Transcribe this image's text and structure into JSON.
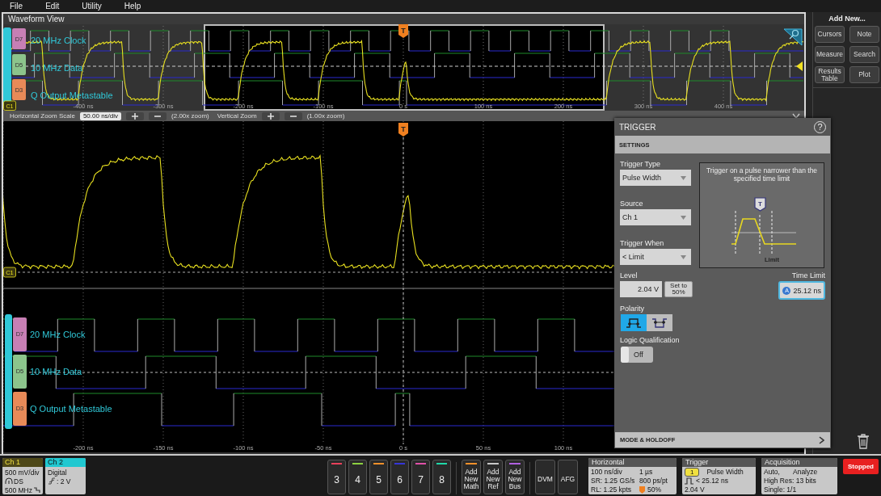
{
  "menu": [
    "File",
    "Edit",
    "Utility",
    "Help"
  ],
  "waveform_view": {
    "title": "Waveform View",
    "overview": {
      "trigger_marker": "T",
      "analog_marker": "C1",
      "channels": [
        {
          "badge": "D7",
          "name": "20 MHz Clock",
          "color": "#c77fb4"
        },
        {
          "badge": "D5",
          "name": "10 MHz Data",
          "color": "#8cc48c"
        },
        {
          "badge": "D3",
          "name": "Q Output Metastable",
          "color": "#e88a58"
        }
      ],
      "time_labels": [
        "-400 ns",
        "-300 ns",
        "-200 ns",
        "-100 ns",
        "0 s",
        "100 ns",
        "200 ns",
        "300 ns",
        "400 ns"
      ]
    },
    "zoom_bar": {
      "horizontal_label": "Horizontal Zoom Scale",
      "horizontal_value": "50.00 ns/div",
      "horizontal_zoom": "(2.00x zoom)",
      "vertical_label": "Vertical Zoom",
      "vertical_zoom": "(1.00x zoom)"
    },
    "main": {
      "trigger_marker": "T",
      "analog_marker": "C1",
      "channels": [
        {
          "badge": "D7",
          "name": "20 MHz Clock",
          "color": "#c77fb4"
        },
        {
          "badge": "D5",
          "name": "10 MHz Data",
          "color": "#8cc48c"
        },
        {
          "badge": "D3",
          "name": "Q Output Metastable",
          "color": "#e88a58"
        }
      ],
      "time_labels": [
        "-200 ns",
        "-150 ns",
        "-100 ns",
        "-50 ns",
        "0 s",
        "50 ns",
        "100 ns"
      ]
    }
  },
  "add_new": {
    "title": "Add New...",
    "buttons": [
      "Cursors",
      "Note",
      "Measure",
      "Search",
      "Results Table",
      "Plot"
    ]
  },
  "trigger_panel": {
    "title": "TRIGGER",
    "help": "?",
    "section": "SETTINGS",
    "trigger_type": {
      "label": "Trigger Type",
      "value": "Pulse Width"
    },
    "source": {
      "label": "Source",
      "value": "Ch 1"
    },
    "trigger_when": {
      "label": "Trigger When",
      "value": "< Limit"
    },
    "diagram": {
      "caption": "Trigger on a pulse narrower than the specified time limit",
      "marker": "T",
      "limit_label": "Limit"
    },
    "level": {
      "label": "Level",
      "value": "2.04 V",
      "set_button": "Set to 50%"
    },
    "time_limit": {
      "label": "Time Limit",
      "badge": "A",
      "value": "25.12 ns"
    },
    "polarity": {
      "label": "Polarity",
      "options": [
        {
          "kind": "positive",
          "selected": true
        },
        {
          "kind": "negative",
          "selected": false
        }
      ]
    },
    "logic_qualification": {
      "label": "Logic Qualification",
      "on": false,
      "state_label": "Off"
    },
    "footer": "MODE & HOLDOFF"
  },
  "bottom_bar": {
    "channels": [
      {
        "title": "Ch 1",
        "kind": "analog",
        "lines": [
          "500 mV/div",
          "DS",
          "500 MHz"
        ]
      },
      {
        "title": "Ch 2",
        "kind": "digital",
        "lines": [
          "Digital",
          ": 2 V"
        ]
      }
    ],
    "channel_buttons": [
      {
        "label": "3",
        "color": "#e8405a"
      },
      {
        "label": "4",
        "color": "#8cd040"
      },
      {
        "label": "5",
        "color": "#f0902a"
      },
      {
        "label": "6",
        "color": "#3535d8"
      },
      {
        "label": "7",
        "color": "#e050a8"
      },
      {
        "label": "8",
        "color": "#20d8a8"
      }
    ],
    "add_buttons": [
      {
        "label": "Add New Math",
        "color": "#f0902a"
      },
      {
        "label": "Add New Ref",
        "color": "#c8c8c8"
      },
      {
        "label": "Add New Bus",
        "color": "#b060e0"
      }
    ],
    "tool_buttons": [
      "DVM",
      "AFG"
    ],
    "horizontal": {
      "title": "Horizontal",
      "cells": [
        "100 ns/div",
        "1 µs",
        "SR: 1.25 GS/s",
        "800 ps/pt",
        "RL: 1.25 kpts",
        "50%"
      ]
    },
    "trigger": {
      "title": "Trigger",
      "source": "1",
      "type": "Pulse Width",
      "condition": "< 25.12 ns",
      "level": "2.04 V"
    },
    "acquisition": {
      "title": "Acquisition",
      "cells": [
        "Auto,",
        "Analyze",
        "High Res: 13 bits",
        "Single: 1/1"
      ]
    },
    "run_state": "Stopped"
  }
}
